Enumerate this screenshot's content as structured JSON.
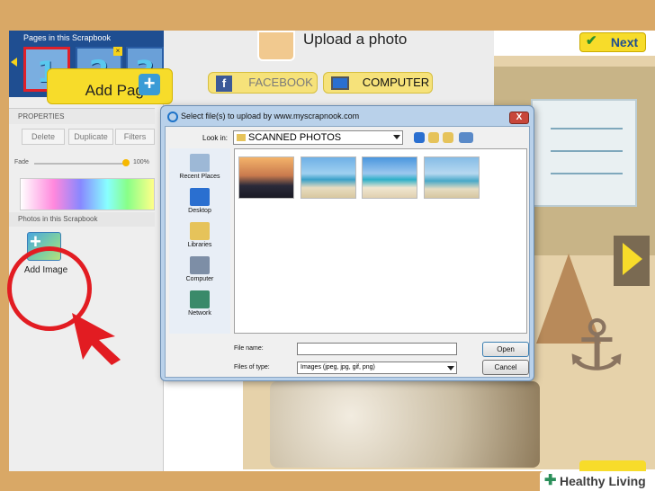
{
  "left_panel": {
    "pages_title": "Pages in this Scrapbook",
    "pages": [
      "1",
      "2",
      "3"
    ],
    "add_page_label": "Add Page",
    "properties_title": "PROPERTIES",
    "property_buttons": [
      "Delete",
      "Duplicate",
      "Filters"
    ],
    "fade_label": "Fade",
    "fade_value": "100%",
    "photos_title": "Photos in this Scrapbook",
    "add_image_label": "Add Image"
  },
  "upload": {
    "title": "Upload a photo",
    "facebook_label": "FACEBOOK",
    "computer_label": "COMPUTER"
  },
  "scrapbook": {
    "next_label": "Next",
    "next_bottom_label": "Next"
  },
  "dialog": {
    "title": "Select file(s) to upload by www.myscrapnook.com",
    "close_label": "X",
    "look_in_label": "Look in:",
    "look_in_value": "SCANNED PHOTOS",
    "places": [
      "Recent Places",
      "Desktop",
      "Libraries",
      "Computer",
      "Network"
    ],
    "file_name_label": "File name:",
    "file_name_value": "",
    "files_of_type_label": "Files of type:",
    "files_of_type_value": "Images (jpeg, jpg, gif, png)",
    "open_label": "Open",
    "cancel_label": "Cancel"
  },
  "watermark": {
    "brand": "Healthy Living"
  },
  "colors": {
    "accent_yellow": "#f7dc2a",
    "brand_blue": "#1f4e91",
    "highlight_red": "#e21c22",
    "board_orange": "#d9a866"
  }
}
